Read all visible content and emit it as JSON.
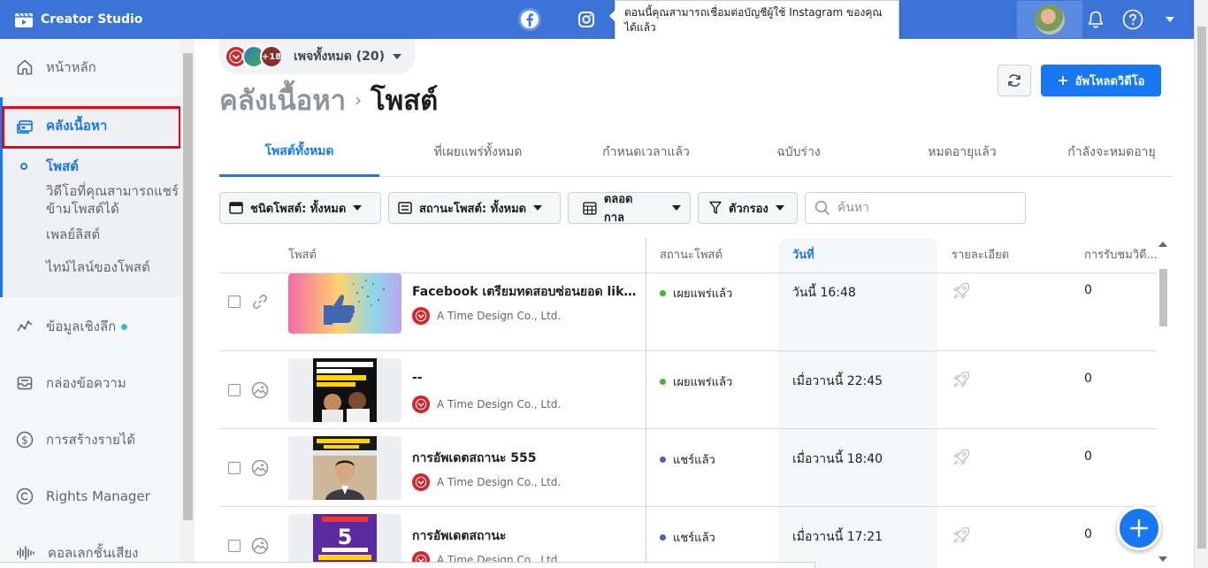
{
  "topbar": {
    "brand": "Creator Studio",
    "tooltip": "ตอนนี้คุณสามารถเชื่อมต่อบัญชีผู้ใช้ Instagram ของคุณได้แล้ว"
  },
  "sidebar": {
    "items": [
      {
        "label": "หน้าหลัก"
      },
      {
        "label": "คลังเนื้อหา"
      },
      {
        "label": "ข้อมูลเชิงลึก"
      },
      {
        "label": "กล่องข้อความ"
      },
      {
        "label": "การสร้างรายได้"
      },
      {
        "label": "Rights Manager"
      },
      {
        "label": "คอลเลกชั้นเสียง"
      }
    ],
    "subitems": [
      {
        "label": "โพสต์"
      },
      {
        "label": "วิดีโอที่คุณสามารถแชร์ข้ามโพสต์ได้"
      },
      {
        "label": "เพลย์ลิสต์"
      },
      {
        "label": "ไทม์ไลน์ของโพสต์"
      }
    ]
  },
  "header": {
    "pages_selector": "เพจทั้งหมด (20)",
    "more_pages_badge": "+18",
    "breadcrumb_parent": "คลังเนื้อหา",
    "breadcrumb_current": "โพสต์",
    "upload_label": "อัพโหลดวิดีโอ"
  },
  "tabs": [
    {
      "label": "โพสต์ทั้งหมด"
    },
    {
      "label": "ที่เผยแพร่ทั้งหมด"
    },
    {
      "label": "กำหนดเวลาแล้ว"
    },
    {
      "label": "ฉบับร่าง"
    },
    {
      "label": "หมดอายุแล้ว"
    },
    {
      "label": "กำลังจะหมดอายุ"
    }
  ],
  "filters": {
    "post_type": "ชนิดโพสต์: ทั้งหมด",
    "post_status": "สถานะโพสต์: ทั้งหมด",
    "date_range": "ตลอดกาล",
    "filter": "ตัวกรอง",
    "search_placeholder": "ค้นหา"
  },
  "table": {
    "columns": [
      "โพสต์",
      "สถานะโพสต์",
      "วันที่",
      "รายละเอียด",
      "การรับชมวิดี..."
    ],
    "rows": [
      {
        "title": "Facebook เตรียมทดสอบซ่อนยอด lik...",
        "page": "A Time Design Co., Ltd.",
        "status": "เผยแพร่แล้ว",
        "status_color": "#42b72a",
        "date": "วันนี้ 16:48",
        "views": "0",
        "type_icon": "link-icon"
      },
      {
        "title": "--",
        "page": "A Time Design Co., Ltd.",
        "status": "เผยแพร่แล้ว",
        "status_color": "#42b72a",
        "date": "เมื่อวานนี้ 22:45",
        "views": "0",
        "type_icon": "photo-icon"
      },
      {
        "title": "การอัพเดตสถานะ 555",
        "page": "A Time Design Co., Ltd.",
        "status": "แชร์แล้ว",
        "status_color": "#4267b2",
        "date": "เมื่อวานนี้ 18:40",
        "views": "0",
        "type_icon": "photo-icon"
      },
      {
        "title": "การอัพเดตสถานะ",
        "page": "A Time Design Co., Ltd.",
        "status": "แชร์แล้ว",
        "status_color": "#4267b2",
        "date": "เมื่อวานนี้ 17:21",
        "views": "0",
        "type_icon": "photo-icon"
      }
    ]
  },
  "colors": {
    "accent": "#1877f2",
    "topbar": "#3b73d8",
    "highlight_box": "#e2061a"
  }
}
